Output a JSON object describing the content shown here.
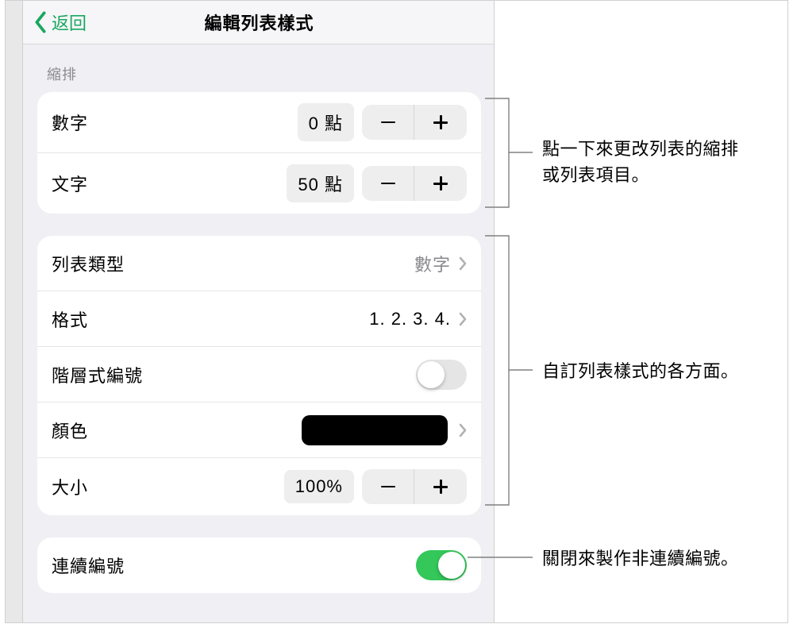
{
  "header": {
    "back_label": "返回",
    "title": "編輯列表樣式"
  },
  "indent": {
    "section_label": "縮排",
    "number_label": "數字",
    "number_value": "0 點",
    "text_label": "文字",
    "text_value": "50 點"
  },
  "options": {
    "list_type_label": "列表類型",
    "list_type_value": "數字",
    "format_label": "格式",
    "format_value": "1. 2. 3. 4.",
    "tiered_label": "階層式編號",
    "tiered_on": false,
    "color_label": "顏色",
    "color_value": "#000000",
    "size_label": "大小",
    "size_value": "100%"
  },
  "continuous": {
    "label": "連續編號",
    "on": true
  },
  "callouts": {
    "c1": "點一下來更改列表的縮排或列表項目。",
    "c2": "自訂列表樣式的各方面。",
    "c3": "關閉來製作非連續編號。"
  }
}
